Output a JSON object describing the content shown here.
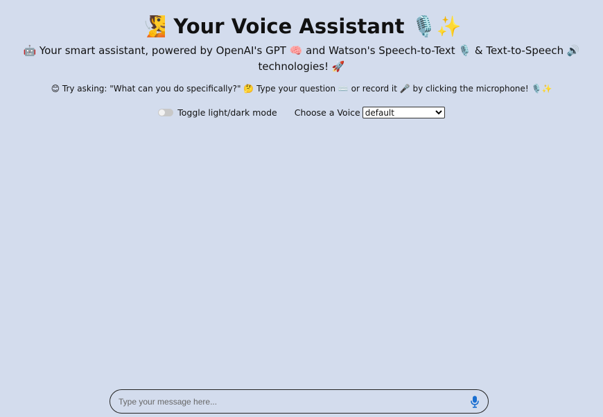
{
  "header": {
    "title": "🧏 Your Voice Assistant 🎙️✨",
    "subtitle": "🤖 Your smart assistant, powered by OpenAI's GPT 🧠 and Watson's Speech-to-Text 🎙️ & Text-to-Speech 🔊 technologies! 🚀",
    "hint": "😊 Try asking: \"What can you do specifically?\" 🤔 Type your question ⌨️ or record it 🎤 by clicking the microphone! 🎙️✨"
  },
  "controls": {
    "toggle_label": "Toggle light/dark mode",
    "toggle_on": false,
    "voice_label": "Choose a Voice",
    "voice_selected": "default"
  },
  "chat_input": {
    "placeholder": "Type your message here...",
    "mic_icon": "microphone-icon"
  },
  "colors": {
    "background": "#d3dced",
    "mic_accent": "#1a6fd1"
  }
}
